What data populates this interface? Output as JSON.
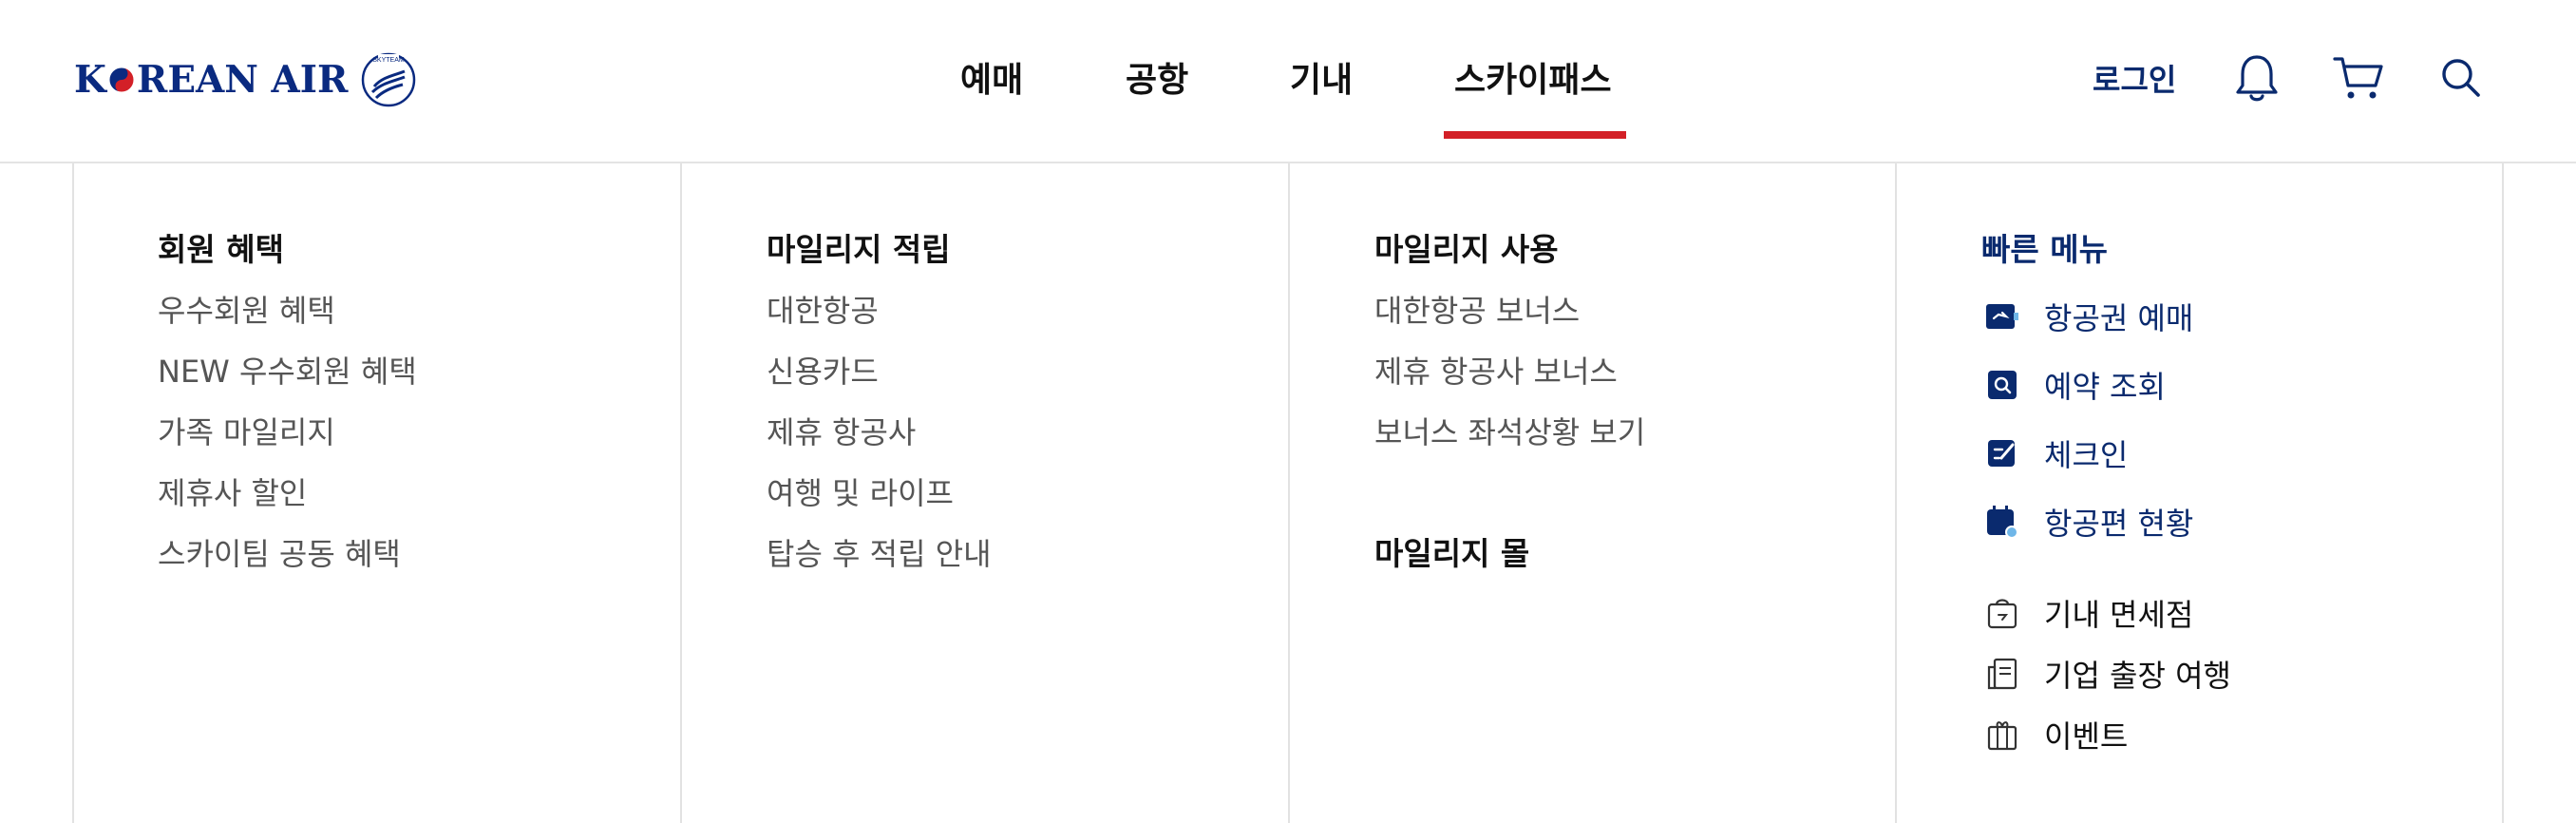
{
  "brand": {
    "name": "KOREAN AIR",
    "emblem_color": "#d32027",
    "brand_color": "#0a2a80",
    "alliance_mark_text": "SKYTEAM"
  },
  "nav": {
    "items": [
      {
        "label": "예매"
      },
      {
        "label": "공항"
      },
      {
        "label": "기내"
      },
      {
        "label": "스카이패스",
        "active": true
      }
    ],
    "active_color": "#d32027"
  },
  "utility": {
    "login_label": "로그인",
    "icons": [
      "bell-icon",
      "cart-icon",
      "search-icon"
    ]
  },
  "menu": {
    "columns": [
      {
        "title": "회원 혜택",
        "links": [
          "우수회원 혜택",
          "NEW 우수회원 혜택",
          "가족 마일리지",
          "제휴사 할인",
          "스카이팀 공동 혜택"
        ]
      },
      {
        "title": "마일리지 적립",
        "links": [
          "대한항공",
          "신용카드",
          "제휴 항공사",
          "여행 및 라이프",
          "탑승 후 적립 안내"
        ]
      },
      {
        "title": "마일리지 사용",
        "links": [
          "대한항공 보너스",
          "제휴 항공사 보너스",
          "보너스 좌석상황 보기"
        ],
        "second_title": "마일리지 몰"
      },
      {
        "title": "빠른 메뉴",
        "quick_links": [
          {
            "label": "항공권 예매",
            "icon": "ticket-icon"
          },
          {
            "label": "예약 조회",
            "icon": "reservation-search-icon"
          },
          {
            "label": "체크인",
            "icon": "checkin-icon"
          },
          {
            "label": "항공편 현황",
            "icon": "flight-status-icon"
          }
        ],
        "other_links": [
          {
            "label": "기내 면세점",
            "icon": "shopping-bag-icon"
          },
          {
            "label": "기업 출장 여행",
            "icon": "document-icon"
          },
          {
            "label": "이벤트",
            "icon": "gift-icon"
          }
        ]
      }
    ]
  }
}
